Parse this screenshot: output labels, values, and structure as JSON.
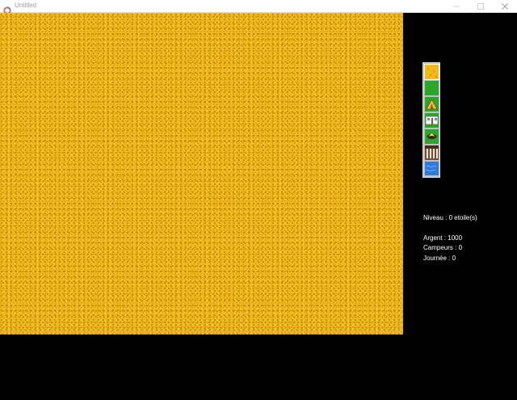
{
  "window": {
    "title": "Untitled"
  },
  "palette": {
    "tiles": [
      {
        "name": "sand",
        "color": "#f2b819"
      },
      {
        "name": "grass",
        "color": "#2aa62a"
      },
      {
        "name": "tent",
        "color": "#2aa62a"
      },
      {
        "name": "building",
        "color": "#2aa62a"
      },
      {
        "name": "campfire",
        "color": "#2aa62a"
      },
      {
        "name": "path-fence",
        "color": "#7a4a2a"
      },
      {
        "name": "water",
        "color": "#2e7be0"
      }
    ]
  },
  "hud": {
    "niveau": "Niveau : 0 etoile(s)",
    "argent": "Argent : 1000",
    "campeurs": "Campeurs : 0",
    "journee": "Journée : 0"
  }
}
